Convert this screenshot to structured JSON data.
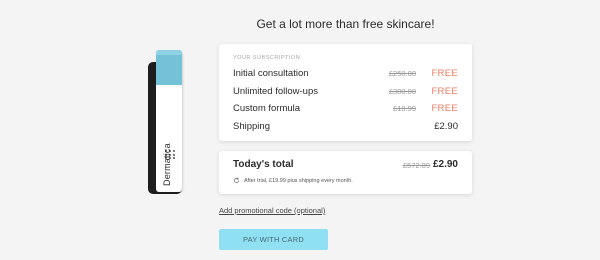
{
  "headline": "Get a lot more than free skincare!",
  "product": {
    "brand": "Dermatica"
  },
  "subscription": {
    "title": "YOUR SUBSCRIPTION",
    "items": [
      {
        "label": "Initial consultation",
        "old_price": "£250.00",
        "price": "FREE"
      },
      {
        "label": "Unlimited follow-ups",
        "old_price": "£300.00",
        "price": "FREE"
      },
      {
        "label": "Custom formula",
        "old_price": "£19.99",
        "price": "FREE"
      }
    ],
    "shipping": {
      "label": "Shipping",
      "price": "£2.90"
    }
  },
  "total": {
    "label": "Today's total",
    "old_price": "£572.89",
    "price": "£2.90",
    "note": "After trial, £19.99 plus shipping every month."
  },
  "promo_link": "Add promotional code (optional)",
  "pay_button": "PAY WITH CARD",
  "colors": {
    "accent_free": "#ee7b62",
    "pay_button_bg": "#8fe0f3",
    "tube_cap": "#74c2d8"
  }
}
